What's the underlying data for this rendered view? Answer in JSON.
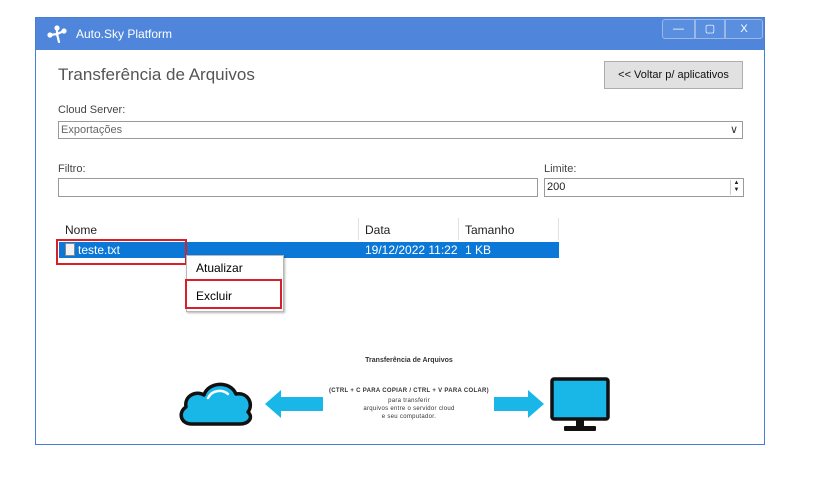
{
  "window": {
    "app_title": "Auto.Sky Platform",
    "controls": {
      "minimize": "—",
      "maximize": "▢",
      "close": "X"
    }
  },
  "page": {
    "title": "Transferência de Arquivos",
    "back_button": "<< Voltar p/ aplicativos"
  },
  "cloud_server": {
    "label": "Cloud Server:",
    "selected": "Exportações"
  },
  "filter": {
    "label": "Filtro:",
    "value": ""
  },
  "limit": {
    "label": "Limite:",
    "value": "200"
  },
  "file_list": {
    "columns": [
      "Nome",
      "Data",
      "Tamanho"
    ],
    "rows": [
      {
        "name": "teste.txt",
        "date": "19/12/2022 11:22",
        "size": "1 KB"
      }
    ]
  },
  "context_menu": {
    "items": [
      "Atualizar",
      "Excluir"
    ]
  },
  "banner": {
    "title": "Transferência de Arquivos",
    "shortcut": "(CTRL + C PARA COPIAR / CTRL + V PARA COLAR)",
    "line1": "para transferir",
    "line2": "arquivos entre o servidor cloud",
    "line3": "e seu computador."
  },
  "colors": {
    "titlebar": "#4f86dc",
    "selection": "#0b78d7",
    "highlight": "#d6202a",
    "banner_blue": "#19b7e8"
  }
}
